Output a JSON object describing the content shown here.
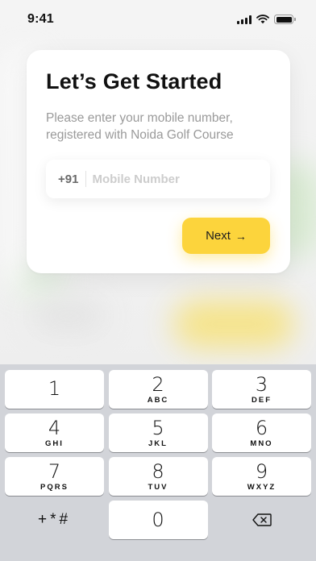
{
  "status": {
    "time": "9:41"
  },
  "card": {
    "title": "Let’s Get Started",
    "subtitle": "Please enter your mobile number, registered with Noida Golf Course",
    "country_code": "+91",
    "phone_placeholder": "Mobile Number",
    "phone_value": "",
    "next_label": "Next",
    "next_icon": "arrow-right-icon",
    "accent_color": "#fcd43c"
  },
  "keypad": {
    "keys": [
      {
        "digit": "1",
        "letters": ""
      },
      {
        "digit": "2",
        "letters": "ABC"
      },
      {
        "digit": "3",
        "letters": "DEF"
      },
      {
        "digit": "4",
        "letters": "GHI"
      },
      {
        "digit": "5",
        "letters": "JKL"
      },
      {
        "digit": "6",
        "letters": "MNO"
      },
      {
        "digit": "7",
        "letters": "PQRS"
      },
      {
        "digit": "8",
        "letters": "TUV"
      },
      {
        "digit": "9",
        "letters": "WXYZ"
      }
    ],
    "symbols": "+*#",
    "zero": "0",
    "delete_icon": "backspace-icon"
  }
}
